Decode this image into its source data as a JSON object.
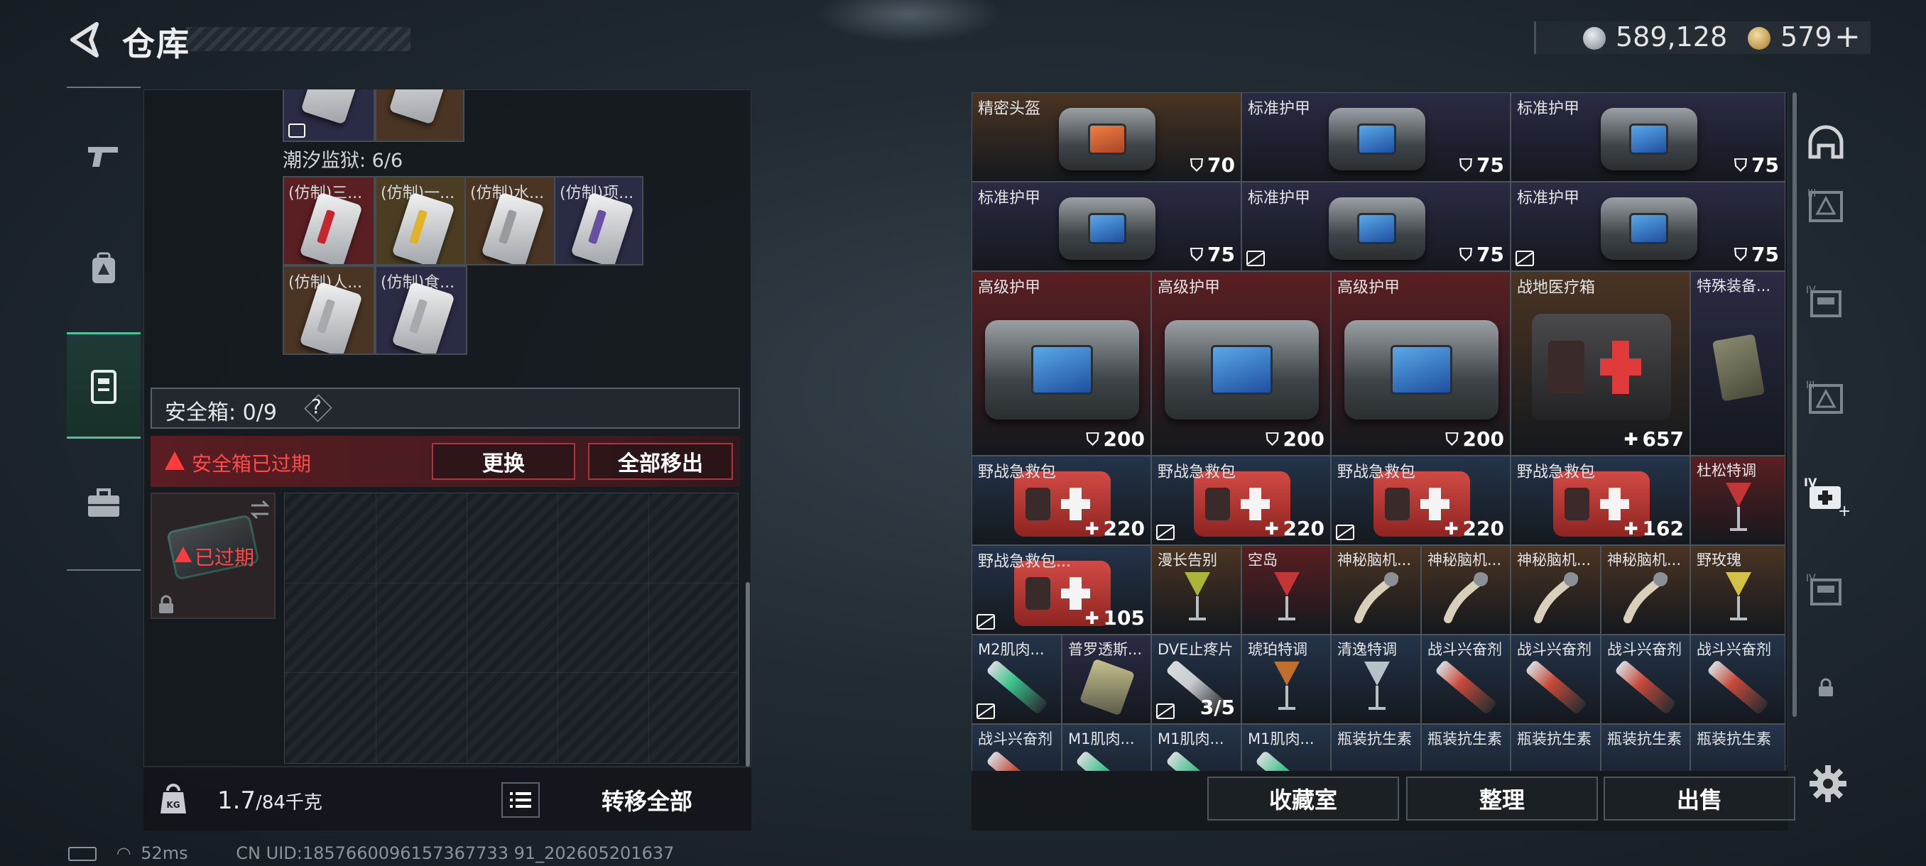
{
  "header": {
    "title": "仓库",
    "silver": "589,128",
    "gold": "579",
    "plus": "+"
  },
  "nav": {
    "items": [
      "weapons",
      "backpack",
      "storage",
      "toolbox"
    ],
    "active_index": 2
  },
  "left": {
    "prison_label": "潮汐监狱: 6/6",
    "cards": [
      {
        "label": "(仿制)三...",
        "color": "#c2282d"
      },
      {
        "label": "(仿制)一...",
        "color": "#e0b32a"
      },
      {
        "label": "(仿制)水...",
        "color": "#9a9aa0"
      },
      {
        "label": "(仿制)项...",
        "color": "#6a4fa0"
      },
      {
        "label": "(仿制)人...",
        "color": "#a8a8ae"
      },
      {
        "label": "(仿制)食...",
        "color": "#a8a8ae"
      }
    ],
    "safebox": {
      "label": "安全箱:",
      "count": "0/9",
      "help": "?"
    },
    "expired_notice": "安全箱已过期",
    "replace_btn": "更换",
    "move_all_btn": "全部移出",
    "expired_tag": "已过期",
    "weight_value": "1.7",
    "weight_max": "/84千克",
    "transfer_all": "转移全部"
  },
  "status": {
    "ping": "52ms",
    "uid": "CN UID:1857660096157367733 91_202605201637"
  },
  "items": [
    {
      "label": "精密头盔",
      "value": "70",
      "kind": "shield",
      "icon": "helmet-bag",
      "mod": false
    },
    {
      "label": "标准护甲",
      "value": "75",
      "kind": "shield",
      "icon": "armor-bag",
      "mod": false
    },
    {
      "label": "标准护甲",
      "value": "75",
      "kind": "shield",
      "icon": "armor-bag",
      "mod": false
    },
    {
      "label": "标准护甲",
      "value": "75",
      "kind": "shield",
      "icon": "armor-bag",
      "mod": false
    },
    {
      "label": "标准护甲",
      "value": "75",
      "kind": "shield",
      "icon": "armor-bag",
      "mod": true
    },
    {
      "label": "标准护甲",
      "value": "75",
      "kind": "shield",
      "icon": "armor-bag",
      "mod": true
    },
    {
      "label": "高级护甲",
      "value": "200",
      "kind": "shield",
      "icon": "armor-bag-large",
      "mod": false
    },
    {
      "label": "高级护甲",
      "value": "200",
      "kind": "shield",
      "icon": "armor-bag-large",
      "mod": false
    },
    {
      "label": "高级护甲",
      "value": "200",
      "kind": "shield",
      "icon": "armor-bag-large",
      "mod": false
    },
    {
      "label": "战地医疗箱",
      "value": "657",
      "kind": "heal",
      "icon": "medkit-large",
      "mod": false
    },
    {
      "label": "特殊装备...",
      "value": "",
      "kind": "",
      "icon": "gear-case",
      "mod": false
    },
    {
      "label": "野战急救包",
      "value": "220",
      "kind": "heal",
      "icon": "medkit",
      "mod": false
    },
    {
      "label": "野战急救包",
      "value": "220",
      "kind": "heal",
      "icon": "medkit",
      "mod": true
    },
    {
      "label": "野战急救包",
      "value": "220",
      "kind": "heal",
      "icon": "medkit",
      "mod": true
    },
    {
      "label": "野战急救包",
      "value": "162",
      "kind": "heal",
      "icon": "medkit",
      "mod": false
    },
    {
      "label": "杜松特调",
      "value": "",
      "kind": "",
      "icon": "drink-red",
      "mod": false
    },
    {
      "label": "野战急救包...",
      "value": "105",
      "kind": "heal",
      "icon": "medkit",
      "mod": true
    },
    {
      "label": "漫长告别",
      "value": "",
      "kind": "",
      "icon": "drink-green",
      "mod": false
    },
    {
      "label": "空岛",
      "value": "",
      "kind": "",
      "icon": "drink-red",
      "mod": false
    },
    {
      "label": "神秘脑机...",
      "value": "",
      "kind": "",
      "icon": "brain-chip",
      "mod": false
    },
    {
      "label": "神秘脑机...",
      "value": "",
      "kind": "",
      "icon": "brain-chip",
      "mod": false
    },
    {
      "label": "神秘脑机...",
      "value": "",
      "kind": "",
      "icon": "brain-chip",
      "mod": false
    },
    {
      "label": "神秘脑机...",
      "value": "",
      "kind": "",
      "icon": "brain-chip",
      "mod": false
    },
    {
      "label": "野玫瑰",
      "value": "",
      "kind": "",
      "icon": "drink-yellow",
      "mod": false
    },
    {
      "label": "M2肌肉...",
      "value": "",
      "kind": "",
      "icon": "syringe-green",
      "mod": true
    },
    {
      "label": "普罗透斯...",
      "value": "",
      "kind": "",
      "icon": "device",
      "mod": false
    },
    {
      "label": "DVE止疼片",
      "value": "3/5",
      "kind": "",
      "icon": "pill",
      "mod": true
    },
    {
      "label": "琥珀特调",
      "value": "",
      "kind": "",
      "icon": "drink-orange",
      "mod": false
    },
    {
      "label": "清逸特调",
      "value": "",
      "kind": "",
      "icon": "drink-clear",
      "mod": false
    },
    {
      "label": "战斗兴奋剂",
      "value": "",
      "kind": "",
      "icon": "syringe-red",
      "mod": false
    },
    {
      "label": "战斗兴奋剂",
      "value": "",
      "kind": "",
      "icon": "syringe-red",
      "mod": false
    },
    {
      "label": "战斗兴奋剂",
      "value": "",
      "kind": "",
      "icon": "syringe-red",
      "mod": false
    },
    {
      "label": "战斗兴奋剂",
      "value": "",
      "kind": "",
      "icon": "syringe-red",
      "mod": false
    },
    {
      "label": "战斗兴奋剂",
      "value": "",
      "kind": "",
      "icon": "syringe-red",
      "mod": false
    },
    {
      "label": "M1肌肉...",
      "value": "",
      "kind": "",
      "icon": "syringe-green",
      "mod": false
    },
    {
      "label": "M1肌肉...",
      "value": "",
      "kind": "",
      "icon": "syringe-green",
      "mod": false
    },
    {
      "label": "M1肌肉...",
      "value": "",
      "kind": "",
      "icon": "syringe-green",
      "mod": false
    },
    {
      "label": "瓶装抗生素",
      "value": "",
      "kind": "",
      "icon": "bottle",
      "mod": false
    },
    {
      "label": "瓶装抗生素",
      "value": "",
      "kind": "",
      "icon": "bottle",
      "mod": false
    },
    {
      "label": "瓶装抗生素",
      "value": "",
      "kind": "",
      "icon": "bottle",
      "mod": false
    },
    {
      "label": "瓶装抗生素",
      "value": "",
      "kind": "",
      "icon": "bottle",
      "mod": false
    },
    {
      "label": "瓶装抗生素",
      "value": "",
      "kind": "",
      "icon": "bottle",
      "mod": false
    }
  ],
  "right_tabs": [
    "helmet-tab-icon",
    "armor-tab-icon",
    "container-tab-iv",
    "armor-tab-iii",
    "medical-tab-iv",
    "container-tab-iv-2",
    "lock-tab-icon"
  ],
  "bottom": {
    "collection": "收藏室",
    "organize": "整理",
    "sell": "出售"
  },
  "colors": {
    "accent_green": "#4ac29a",
    "warning_red": "#ff4a4a",
    "rarity_red": "#5a1f22",
    "rarity_orange": "#4a3423",
    "rarity_blue": "#24344a",
    "rarity_purple": "#2a2b44"
  }
}
